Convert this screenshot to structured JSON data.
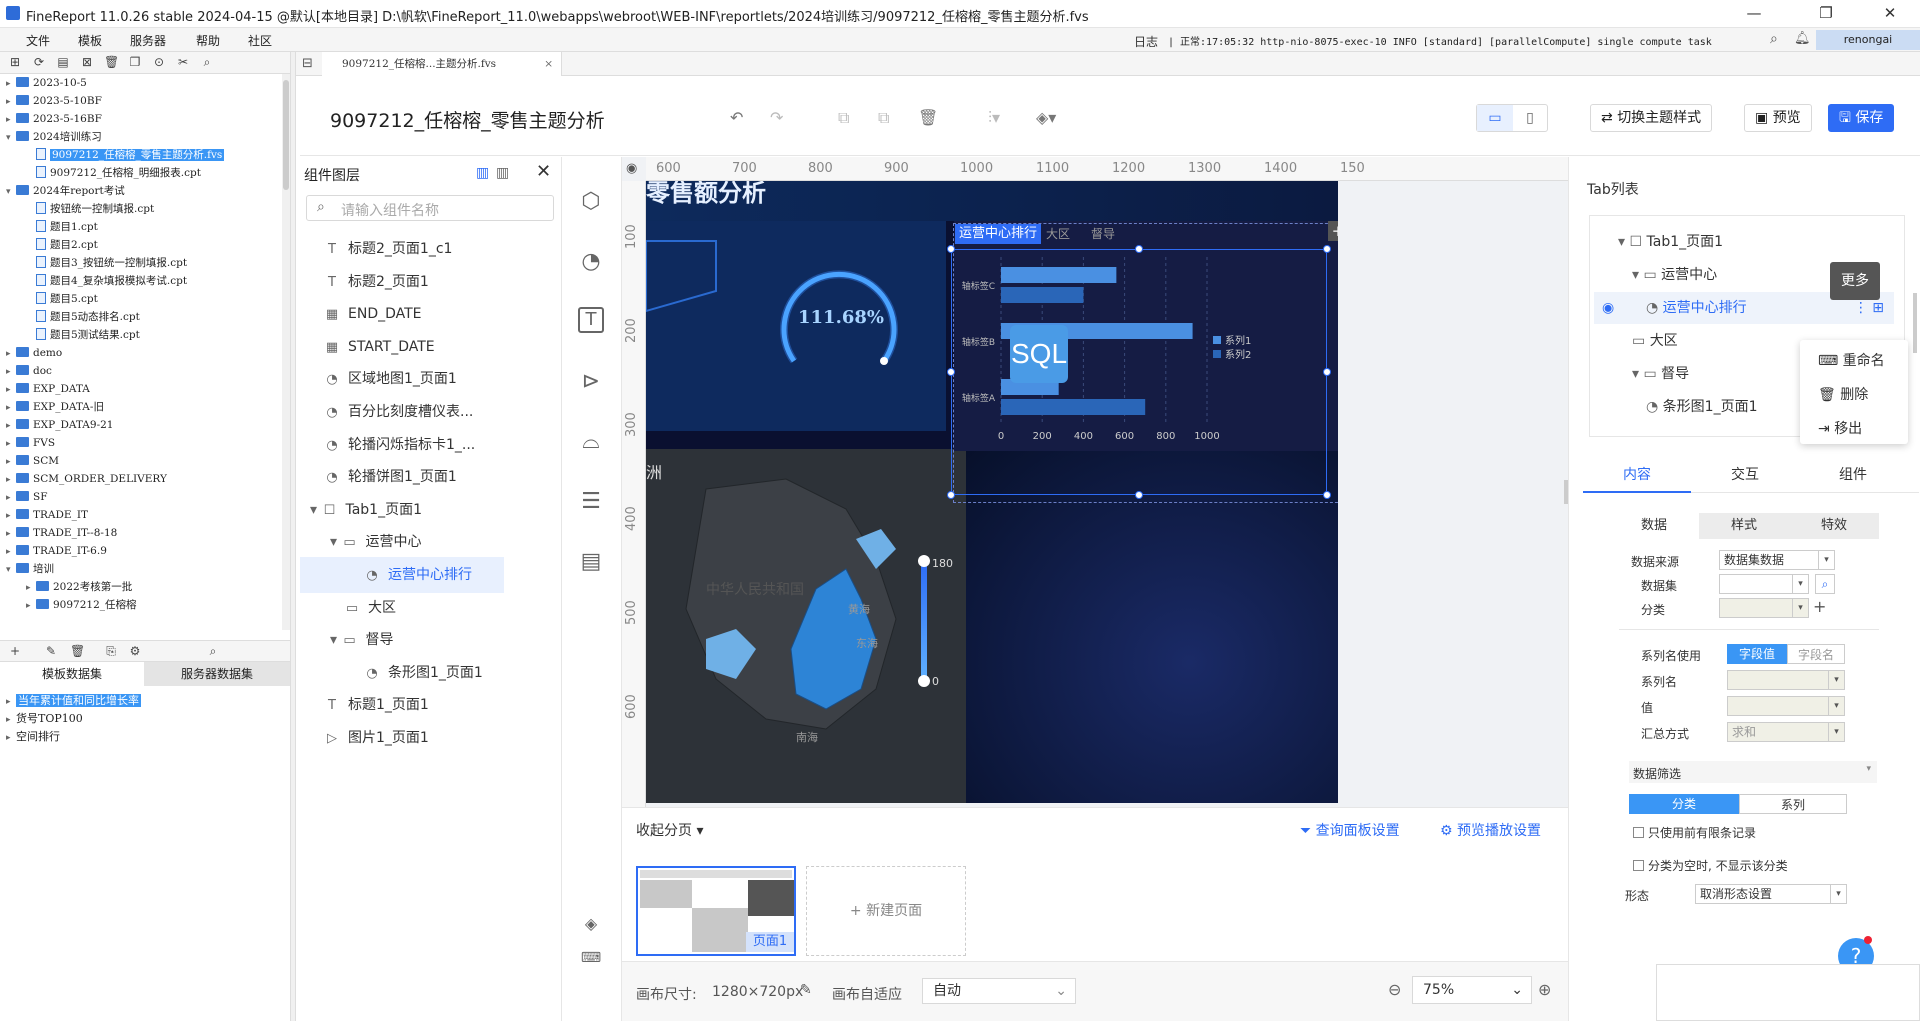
{
  "app": {
    "title": "FineReport 11.0.26 stable 2024-04-15 @默认[本地目录]    D:\\帆软\\FineReport_11.0\\webapps\\webroot\\WEB-INF\\reportlets/2024培训练习/9097212_任榕榕_零售主题分析.fvs"
  },
  "menu": [
    "文件",
    "模板",
    "服务器",
    "帮助",
    "社区"
  ],
  "status": {
    "log_label": "日志",
    "log_text": "| 正常:17:05:32 http-nio-8075-exec-10 INFO [standard] [parallelCompute] single compute task",
    "user": "renongai"
  },
  "tree": [
    {
      "label": "2023-10-5",
      "depth": 0,
      "type": "folder",
      "arrow": "▸"
    },
    {
      "label": "2023-5-10BF",
      "depth": 0,
      "type": "folder",
      "arrow": "▸"
    },
    {
      "label": "2023-5-16BF",
      "depth": 0,
      "type": "folder",
      "arrow": "▸"
    },
    {
      "label": "2024培训练习",
      "depth": 0,
      "type": "folder",
      "arrow": "▾"
    },
    {
      "label": "9097212_任榕榕_零售主题分析.fvs",
      "depth": 1,
      "type": "file",
      "selected": true
    },
    {
      "label": "9097212_任榕榕_明细报表.cpt",
      "depth": 1,
      "type": "file"
    },
    {
      "label": "2024年report考试",
      "depth": 0,
      "type": "folder",
      "arrow": "▾"
    },
    {
      "label": "按钮统一控制填报.cpt",
      "depth": 1,
      "type": "file"
    },
    {
      "label": "题目1.cpt",
      "depth": 1,
      "type": "file"
    },
    {
      "label": "题目2.cpt",
      "depth": 1,
      "type": "file"
    },
    {
      "label": "题目3_按钮统一控制填报.cpt",
      "depth": 1,
      "type": "file"
    },
    {
      "label": "题目4_复杂填报模拟考试.cpt",
      "depth": 1,
      "type": "file"
    },
    {
      "label": "题目5.cpt",
      "depth": 1,
      "type": "file"
    },
    {
      "label": "题目5动态排名.cpt",
      "depth": 1,
      "type": "file"
    },
    {
      "label": "题目5测试结果.cpt",
      "depth": 1,
      "type": "file"
    },
    {
      "label": "demo",
      "depth": 0,
      "type": "folder",
      "arrow": "▸"
    },
    {
      "label": "doc",
      "depth": 0,
      "type": "folder",
      "arrow": "▸"
    },
    {
      "label": "EXP_DATA",
      "depth": 0,
      "type": "folder",
      "arrow": "▸"
    },
    {
      "label": "EXP_DATA-旧",
      "depth": 0,
      "type": "folder",
      "arrow": "▸"
    },
    {
      "label": "EXP_DATA9-21",
      "depth": 0,
      "type": "folder",
      "arrow": "▸"
    },
    {
      "label": "FVS",
      "depth": 0,
      "type": "folder",
      "arrow": "▸"
    },
    {
      "label": "SCM",
      "depth": 0,
      "type": "folder",
      "arrow": "▸"
    },
    {
      "label": "SCM_ORDER_DELIVERY",
      "depth": 0,
      "type": "folder",
      "arrow": "▸"
    },
    {
      "label": "SF",
      "depth": 0,
      "type": "folder",
      "arrow": "▸"
    },
    {
      "label": "TRADE_IT",
      "depth": 0,
      "type": "folder",
      "arrow": "▸"
    },
    {
      "label": "TRADE_IT--8-18",
      "depth": 0,
      "type": "folder",
      "arrow": "▸"
    },
    {
      "label": "TRADE_IT-6.9",
      "depth": 0,
      "type": "folder",
      "arrow": "▸"
    },
    {
      "label": "培训",
      "depth": 0,
      "type": "folder",
      "arrow": "▾"
    },
    {
      "label": "2022考核第一批",
      "depth": 1,
      "type": "folder",
      "arrow": "▸"
    },
    {
      "label": "9097212_任榕榕",
      "depth": 1,
      "type": "folder",
      "arrow": "▸"
    }
  ],
  "datasets": {
    "tab1": "模板数据集",
    "tab2": "服务器数据集",
    "items": [
      "当年累计值和同比增长率",
      "货号TOP100",
      "空间排行"
    ]
  },
  "doc_tab": "9097212_任榕榕...主题分析.fvs",
  "page_title": "9097212_任榕榕_零售主题分析",
  "header_buttons": {
    "theme": "切换主题样式",
    "preview": "预览",
    "save": "保存"
  },
  "layers": {
    "title": "组件图层",
    "search_placeholder": "请输入组件名称",
    "items": [
      {
        "label": "标题2_页面1_c1",
        "indent": 0,
        "icon": "T"
      },
      {
        "label": "标题2_页面1",
        "indent": 0,
        "icon": "T"
      },
      {
        "label": "END_DATE",
        "indent": 0,
        "icon": "▦"
      },
      {
        "label": "START_DATE",
        "indent": 0,
        "icon": "▦"
      },
      {
        "label": "区域地图1_页面1",
        "indent": 0,
        "icon": "◔"
      },
      {
        "label": "百分比刻度槽仪表...",
        "indent": 0,
        "icon": "◔"
      },
      {
        "label": "轮播闪烁指标卡1_...",
        "indent": 0,
        "icon": "◔"
      },
      {
        "label": "轮播饼图1_页面1",
        "indent": 0,
        "icon": "◔"
      },
      {
        "label": "Tab1_页面1",
        "indent": 0,
        "icon": "☐",
        "arrow": "▾"
      },
      {
        "label": "运营中心",
        "indent": 1,
        "icon": "▭",
        "arrow": "▾"
      },
      {
        "label": "运营中心排行",
        "indent": 2,
        "icon": "◔",
        "selected": true
      },
      {
        "label": "大区",
        "indent": 1,
        "icon": "▭"
      },
      {
        "label": "督导",
        "indent": 1,
        "icon": "▭",
        "arrow": "▾"
      },
      {
        "label": "条形图1_页面1",
        "indent": 2,
        "icon": "◔"
      },
      {
        "label": "标题1_页面1",
        "indent": 0,
        "icon": "T"
      },
      {
        "label": "图片1_页面1",
        "indent": 0,
        "icon": "▷"
      }
    ]
  },
  "ruler_h": [
    "600",
    "700",
    "800",
    "900",
    "1000",
    "1100",
    "1200",
    "1300",
    "1400",
    "150"
  ],
  "ruler_v": [
    "100",
    "200",
    "300",
    "400",
    "500",
    "600"
  ],
  "canvas": {
    "banner": "零售额分析",
    "gauge_value": "111.68%",
    "region_text": "洲",
    "map_label": "中华人民共和国",
    "sea1": "黄海",
    "sea2": "东海",
    "sea3": "南海",
    "scale_max": "180",
    "scale_min": "0",
    "tabs": [
      "运营中心排行",
      "大区",
      "督导"
    ],
    "sql_badge": "SQL"
  },
  "chart_data": {
    "type": "bar",
    "orientation": "horizontal",
    "categories": [
      "轴标签C",
      "轴标签B",
      "轴标签A"
    ],
    "series": [
      {
        "name": "系列1",
        "values": [
          560,
          930,
          280
        ],
        "color": "#4a90e2"
      },
      {
        "name": "系列2",
        "values": [
          400,
          0,
          700
        ],
        "color": "#2a66b8"
      }
    ],
    "xlim": [
      0,
      1000
    ],
    "xticks": [
      "0",
      "200",
      "400",
      "600",
      "800",
      "1000"
    ],
    "legend": "right"
  },
  "pager": {
    "collapse": "收起分页",
    "query_settings": "查询面板设置",
    "play_settings": "预览播放设置",
    "page1": "页面1",
    "new_page": "新建页面"
  },
  "footer": {
    "size_label": "画布尺寸:",
    "size_value": "1280×720px",
    "adapt_label": "画布自适应",
    "adapt_value": "自动",
    "zoom": "75%"
  },
  "right": {
    "tab_list_title": "Tab列表",
    "tabtree": [
      {
        "label": "Tab1_页面1",
        "indent": 0,
        "arrow": "▾",
        "icon": "☐"
      },
      {
        "label": "运营中心",
        "indent": 1,
        "arrow": "▾",
        "icon": "▭"
      },
      {
        "label": "运营中心排行",
        "indent": 2,
        "icon": "◔",
        "selected": true
      },
      {
        "label": "大区",
        "indent": 1,
        "icon": "▭"
      },
      {
        "label": "督导",
        "indent": 1,
        "arrow": "▾",
        "icon": "▭"
      },
      {
        "label": "条形图1_页面1",
        "indent": 2,
        "icon": "◔"
      }
    ],
    "more_tooltip": "更多",
    "context_menu": [
      "重命名",
      "删除",
      "移出"
    ],
    "tabs": [
      "内容",
      "交互",
      "组件"
    ],
    "subtabs": [
      "数据",
      "样式",
      "特效"
    ],
    "fields": {
      "data_source_label": "数据来源",
      "data_source_value": "数据集数据",
      "dataset_label": "数据集",
      "category_label": "分类",
      "series_name_use": "系列名使用",
      "seg_field_value": "字段值",
      "seg_field_name": "字段名",
      "series_name": "系列名",
      "value": "值",
      "summary": "汇总方式",
      "summary_value": "求和",
      "data_filter": "数据筛选",
      "filter_tab1": "分类",
      "filter_tab2": "系列",
      "only_first": "只使用前有限条记录",
      "hide_empty": "分类为空时, 不显示该分类",
      "shape_label": "形态",
      "shape_value": "取消形态设置"
    }
  },
  "colors": {
    "accent": "#2e6cf5",
    "canvas_bg": "#0a1030",
    "bar1": "#4a90e2",
    "bar2": "#2a66b8",
    "select": "#3a96f5"
  }
}
